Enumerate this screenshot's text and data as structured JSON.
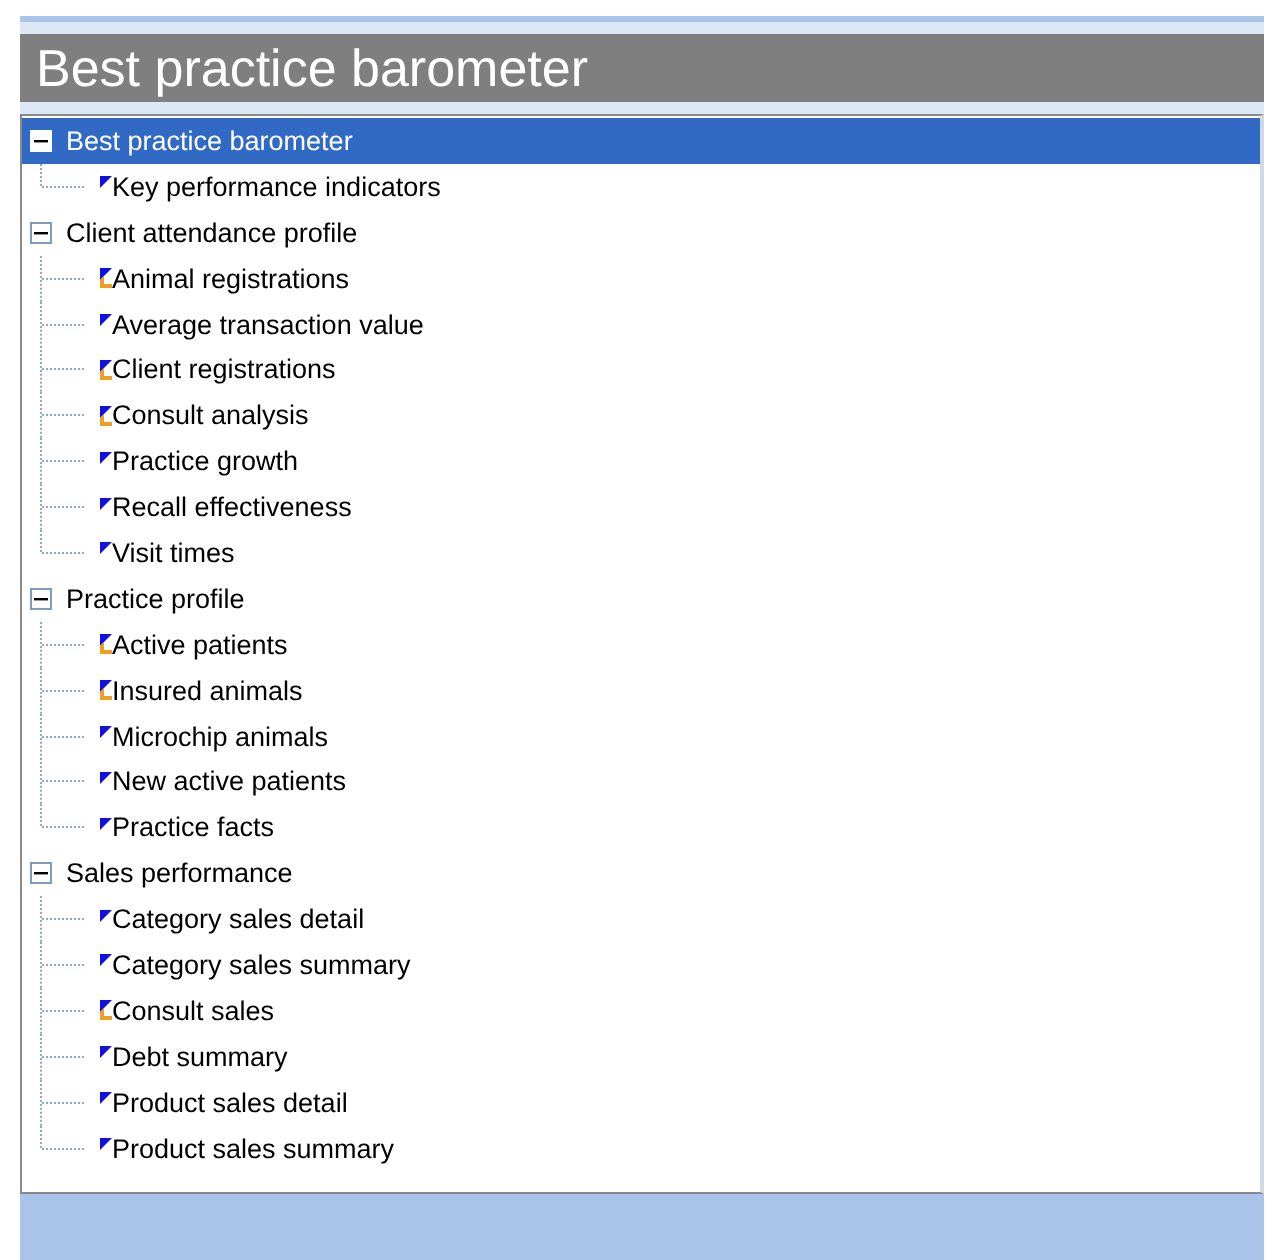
{
  "title": "Best practice barometer",
  "tree": [
    {
      "label": "Best practice barometer",
      "expanded": true,
      "selected": true,
      "children": [
        {
          "label": "Key performance indicators",
          "kind": "plain",
          "selected": false
        }
      ]
    },
    {
      "label": "Client attendance profile",
      "expanded": true,
      "selected": false,
      "children": [
        {
          "label": "Animal registrations",
          "kind": "flagged",
          "selected": false
        },
        {
          "label": "Average transaction value",
          "kind": "plain",
          "selected": false
        },
        {
          "label": "Client registrations",
          "kind": "flagged",
          "selected": false
        },
        {
          "label": "Consult analysis",
          "kind": "flagged",
          "selected": false
        },
        {
          "label": "Practice growth",
          "kind": "plain",
          "selected": false
        },
        {
          "label": "Recall effectiveness",
          "kind": "plain",
          "selected": false
        },
        {
          "label": "Visit times",
          "kind": "plain",
          "selected": false
        }
      ]
    },
    {
      "label": "Practice profile",
      "expanded": true,
      "selected": false,
      "children": [
        {
          "label": "Active patients",
          "kind": "flagged",
          "selected": false
        },
        {
          "label": "Insured animals",
          "kind": "flagged",
          "selected": false
        },
        {
          "label": "Microchip animals",
          "kind": "plain",
          "selected": false
        },
        {
          "label": "New active patients",
          "kind": "plain",
          "selected": false
        },
        {
          "label": "Practice facts",
          "kind": "plain",
          "selected": false
        }
      ]
    },
    {
      "label": "Sales performance",
      "expanded": true,
      "selected": false,
      "children": [
        {
          "label": "Category sales detail",
          "kind": "plain",
          "selected": false
        },
        {
          "label": "Category sales summary",
          "kind": "plain",
          "selected": false
        },
        {
          "label": "Consult sales",
          "kind": "flagged",
          "selected": false
        },
        {
          "label": "Debt summary",
          "kind": "plain",
          "selected": false
        },
        {
          "label": "Product sales detail",
          "kind": "plain",
          "selected": false
        },
        {
          "label": "Product sales summary",
          "kind": "plain",
          "selected": false
        }
      ]
    }
  ]
}
